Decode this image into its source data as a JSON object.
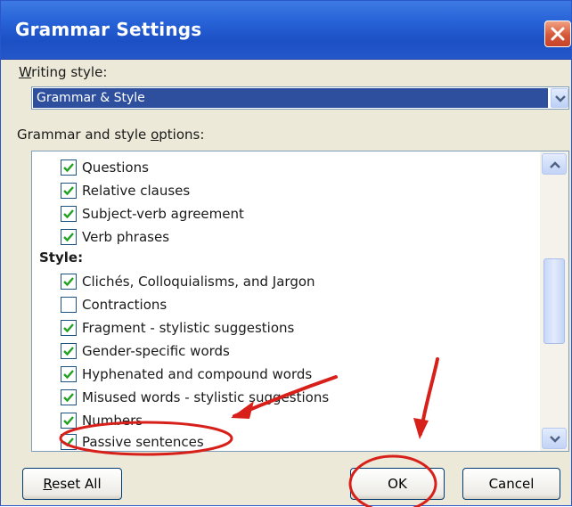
{
  "window": {
    "title": "Grammar Settings"
  },
  "writing_style": {
    "label_prefix": "W",
    "label_rest": "riting style:",
    "selected": "Grammar & Style"
  },
  "options": {
    "label_prefix": "Grammar and style ",
    "label_underlined": "o",
    "label_rest": "ptions:",
    "category_style": "Style:",
    "items": [
      {
        "label": "Questions",
        "checked": true
      },
      {
        "label": "Relative clauses",
        "checked": true
      },
      {
        "label": "Subject-verb agreement",
        "checked": true
      },
      {
        "label": "Verb phrases",
        "checked": true
      },
      {
        "label": "Clichés, Colloquialisms, and Jargon",
        "checked": true
      },
      {
        "label": "Contractions",
        "checked": false
      },
      {
        "label": "Fragment - stylistic suggestions",
        "checked": true
      },
      {
        "label": "Gender-specific words",
        "checked": true
      },
      {
        "label": "Hyphenated and compound words",
        "checked": true
      },
      {
        "label": "Misused words - stylistic suggestions",
        "checked": true
      },
      {
        "label": "Numbers",
        "checked": true
      },
      {
        "label": "Passive sentences",
        "checked": true
      }
    ]
  },
  "buttons": {
    "reset_prefix": "R",
    "reset_rest": "eset All",
    "ok": "OK",
    "cancel": "Cancel"
  },
  "colors": {
    "titlebar": "#2863d8",
    "selection": "#2d4f9e",
    "annotation_red": "#d8201b"
  },
  "icons": {
    "close": "close-icon",
    "dropdown": "chevron-down-icon",
    "scroll_up": "chevron-up-icon",
    "scroll_down": "chevron-down-icon",
    "check": "check-icon"
  }
}
